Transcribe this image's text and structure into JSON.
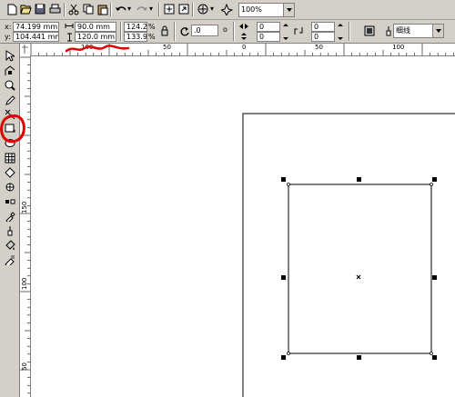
{
  "toolbar_top": {
    "icons": [
      "new-icon",
      "open-icon",
      "save-icon",
      "print-icon",
      "cut-icon",
      "copy-icon",
      "paste-icon",
      "undo-icon",
      "redo-icon",
      "import-icon",
      "export-icon",
      "app-launcher-icon",
      "corel-online-icon"
    ],
    "zoom_value": "100%"
  },
  "property_bar": {
    "x_label": "x:",
    "x_value": "74.199 mm",
    "y_label": "y:",
    "y_value": "104.441 mm",
    "width_value": "90.0 mm",
    "height_value": "120.0 mm",
    "scale_x": "124.2",
    "scale_y": "133.9",
    "percent": "%",
    "rotation_value": ".0",
    "degree": "o",
    "corner_values": [
      "0",
      "0",
      "0",
      "0"
    ],
    "outline_value": "细线"
  },
  "toolbox": {
    "tools": [
      "pick-tool-icon",
      "shape-tool-icon",
      "zoom-tool-icon",
      "freehand-tool-icon",
      "smart-fill-icon",
      "rectangle-tool-icon",
      "ellipse-tool-icon",
      "polygon-tool-icon",
      "basic-shapes-icon",
      "text-tool-icon",
      "interactive-blend-icon",
      "eyedropper-icon",
      "outline-tool-icon",
      "fill-tool-icon",
      "interactive-fill-icon"
    ]
  },
  "rulers": {
    "h_labels": [
      "100",
      "50",
      "0",
      "50",
      "100"
    ],
    "v_labels": [
      "150",
      "100",
      "50"
    ]
  },
  "colors": {
    "chrome": "#d4d0c8",
    "annotation": "#e00000"
  }
}
